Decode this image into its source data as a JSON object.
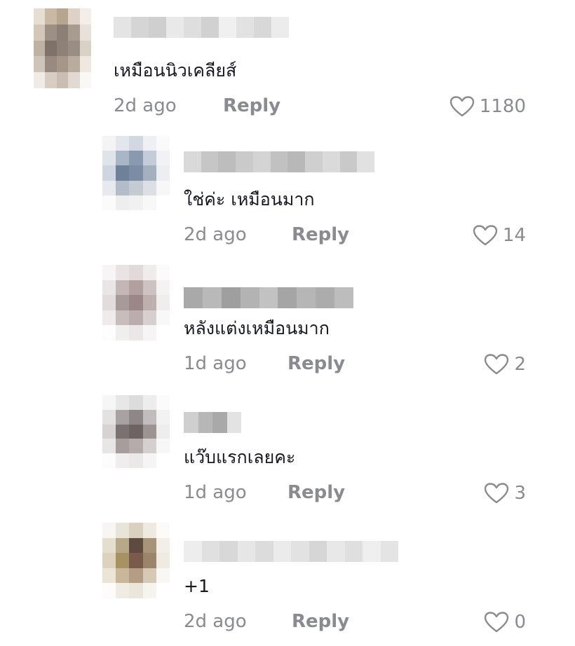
{
  "colors": {
    "text": "#161823",
    "secondary": "#8a8b91"
  },
  "comments": [
    {
      "text": "เหมือนนิวเคลียส์",
      "time": "2d ago",
      "reply": "Reply",
      "likes": "1180"
    },
    {
      "text": "ใช่ค่ะ เหมือนมาก",
      "time": "2d ago",
      "reply": "Reply",
      "likes": "14"
    },
    {
      "text": "หลังแต่งเหมือนมาก",
      "time": "1d ago",
      "reply": "Reply",
      "likes": "2"
    },
    {
      "text": "แว๊บแรกเลยคะ",
      "time": "1d ago",
      "reply": "Reply",
      "likes": "3"
    },
    {
      "text": "+1",
      "time": "2d ago",
      "reply": "Reply",
      "likes": "0"
    }
  ]
}
